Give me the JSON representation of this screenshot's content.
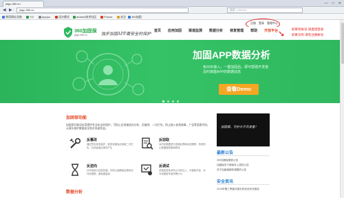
{
  "browser": {
    "tab_title": "jiagu.360.cn",
    "url": "jiagu.360.cn",
    "search_placeholder": "搜索 <Ctrl+K>",
    "window_controls": [
      "—",
      "□",
      "✕"
    ],
    "bookmarks": [
      {
        "label": "常用网址导航",
        "color": "#3b7bd6"
      },
      {
        "label": "T.D",
        "color": "#2e9a4a"
      },
      {
        "label": "ipoppu",
        "color": "#888888"
      },
      {
        "label": "设计模式",
        "color": "#d33a2a"
      },
      {
        "label": "android技术社区",
        "color": "#2e9a4a"
      },
      {
        "label": "Freuse",
        "color": "#d9441a"
      },
      {
        "label": "关注",
        "color": "#e0a020"
      },
      {
        "label": "360加固",
        "color": "#3b7bd6"
      }
    ]
  },
  "site": {
    "toplinks": [
      "注册",
      "登录",
      "管理中心"
    ],
    "logo": {
      "name": "360加固保",
      "domain": "jiagu.360.cn"
    },
    "slogan": "独步加固APP最安全的保护",
    "nav": [
      {
        "label": "首页",
        "selected": false
      },
      {
        "label": "应用加固",
        "selected": false
      },
      {
        "label": "渠道监测",
        "selected": false
      },
      {
        "label": "数据分析",
        "selected": false
      },
      {
        "label": "修复管理",
        "selected": false
      },
      {
        "label": "帮助",
        "selected": false
      },
      {
        "label": "开放平台",
        "selected": true
      }
    ],
    "annotations": [
      "如果有帐号,请直接登录",
      "如果没有,请先注册帐号"
    ],
    "accent": "#e34a2a",
    "brand": "#2fb85e"
  },
  "banner": {
    "title": "加固APP数据分析",
    "subtitle_line1": "免SDK接入，一键加固后，即可帮助开发者",
    "subtitle_line2": "及时掌握APP的数据动态",
    "button": "查看Demo",
    "slides": 4,
    "active_slide": 1
  },
  "main": {
    "section1_title": "加固保功能",
    "intro": "加固保为移动应用提供专业安全的保护，可防止应用被逆向分析、反编译、二次打包，防止嵌入各类病毒、广告等恶意代码，从源头保护数据安全和开发者利益。",
    "features": [
      {
        "name": "反篡改",
        "icon": "wrench-icon",
        "desc": "通过签名校验保护，能有效避免应用被二次打包，杜绝盗版应用的产生"
      },
      {
        "name": "反窃取",
        "icon": "document-search-icon",
        "desc": "对内存数据进行变换处理和动态跟踪，有效防止数据被获取和修改"
      },
      {
        "name": "反逆向",
        "icon": "hourglass-icon",
        "desc": "对代码进行加密压缩，可防止破解者还原真实代码逻辑，避免被复制"
      },
      {
        "name": "反调试",
        "icon": "debug-icon",
        "desc": "多重加密技术防止代码注入，可避免外挂、木马窃取账号密码等行为"
      }
    ],
    "section2_title": "数据分析"
  },
  "side": {
    "video_caption": "加固保，守护大千开发者！",
    "notice_title": "最新公告",
    "notices": [
      "360加固保更新公告",
      "加固保关于新版本上线的公告",
      "关于加固保服务调整的公告"
    ],
    "security_title": "安全资讯",
    "security_items": [
      "2015年第三季度中国手机安全状况报告"
    ]
  }
}
